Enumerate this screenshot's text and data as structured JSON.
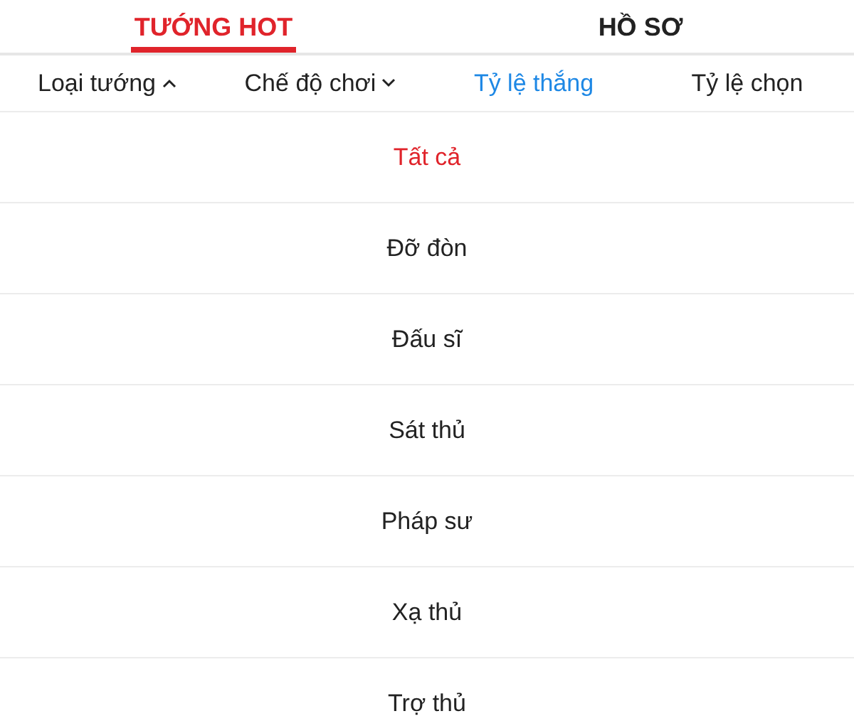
{
  "tabs": [
    {
      "label": "TƯỚNG HOT",
      "selected": true
    },
    {
      "label": "HỒ SƠ",
      "selected": false
    }
  ],
  "sort_bar": [
    {
      "label": "Loại tướng",
      "kind": "dropdown",
      "expanded": true,
      "selected": false
    },
    {
      "label": "Chế độ chơi",
      "kind": "dropdown",
      "expanded": false,
      "selected": false
    },
    {
      "label": "Tỷ lệ thắng",
      "kind": "sort",
      "selected": true
    },
    {
      "label": "Tỷ lệ chọn",
      "kind": "sort",
      "selected": false
    }
  ],
  "roles": [
    {
      "label": "Tất cả",
      "selected": true
    },
    {
      "label": "Đỡ đòn",
      "selected": false
    },
    {
      "label": "Đấu sĩ",
      "selected": false
    },
    {
      "label": "Sát thủ",
      "selected": false
    },
    {
      "label": "Pháp sư",
      "selected": false
    },
    {
      "label": "Xạ thủ",
      "selected": false
    },
    {
      "label": "Trợ thủ",
      "selected": false
    }
  ]
}
